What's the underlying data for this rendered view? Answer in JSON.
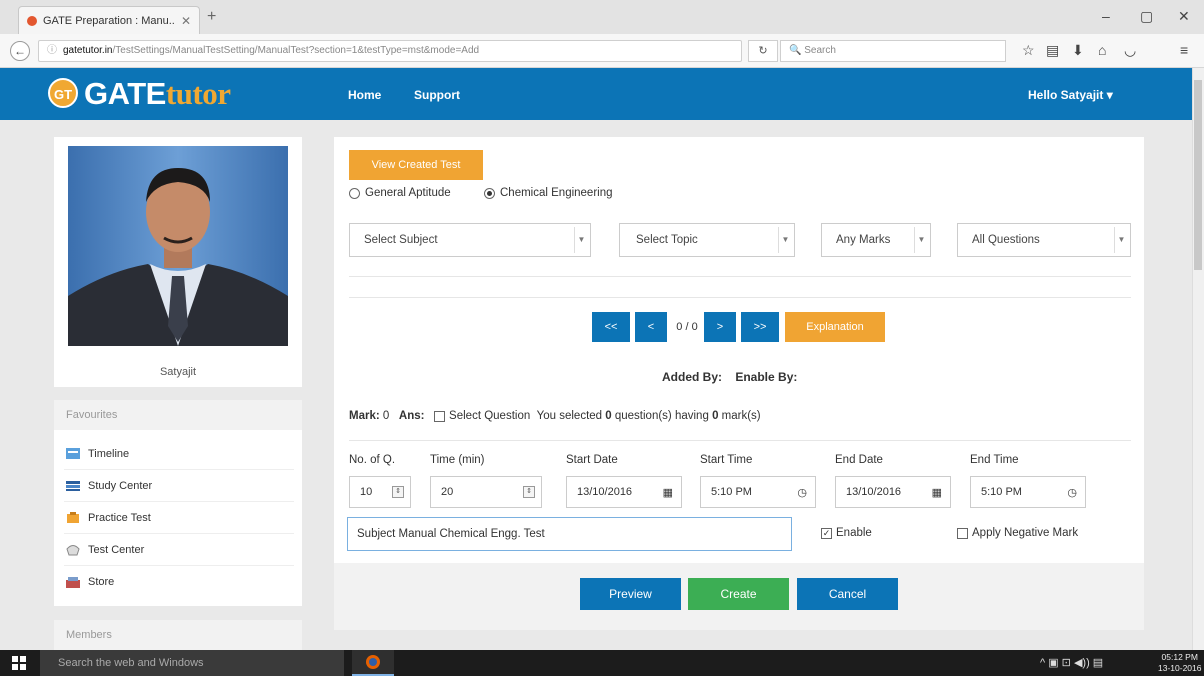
{
  "browser": {
    "tab_title": "GATE Preparation : Manu...",
    "url_host": "gatetutor.in",
    "url_path": "/TestSettings/ManualTestSetting/ManualTest?section=1&testType=mst&mode=Add",
    "search_placeholder": "Search",
    "reload_icon": "↻",
    "icons": [
      "star-icon",
      "reader-icon",
      "download-icon",
      "home-icon",
      "pocket-icon",
      "menu-icon"
    ]
  },
  "site": {
    "logo_badge": "GT",
    "logo_main": "GATE",
    "logo_sub": "tutor",
    "nav": [
      "Home",
      "Support"
    ],
    "user_menu": "Hello Satyajit ▾",
    "brand_color": "#0c74b6",
    "accent_color": "#f0a433"
  },
  "sidebar": {
    "username": "Satyajit",
    "favourites_heading": "Favourites",
    "items": [
      {
        "label": "Timeline",
        "icon": "timeline-icon"
      },
      {
        "label": "Study Center",
        "icon": "study-center-icon"
      },
      {
        "label": "Practice Test",
        "icon": "practice-test-icon"
      },
      {
        "label": "Test Center",
        "icon": "test-center-icon"
      },
      {
        "label": "Store",
        "icon": "store-icon"
      }
    ],
    "members_heading": "Members"
  },
  "main": {
    "view_created_label": "View Created Test",
    "radios": [
      {
        "label": "General Aptitude",
        "checked": false
      },
      {
        "label": "Chemical Engineering",
        "checked": true
      }
    ],
    "selects": [
      "Select Subject",
      "Select Topic",
      "Any Marks",
      "All Questions"
    ],
    "pager": {
      "first": "<<",
      "prev": "<",
      "counter": "0 / 0",
      "next": ">",
      "last": ">>"
    },
    "explanation_label": "Explanation",
    "added_by_label": "Added By:",
    "enable_by_label": "Enable By:",
    "mark_label": "Mark:",
    "mark_value": "0",
    "ans_label": "Ans:",
    "select_question_label": "Select Question",
    "selected_prefix": "You selected",
    "selected_count": "0",
    "selected_mid": "question(s) having",
    "selected_marks": "0",
    "selected_suffix": "mark(s)",
    "fields": {
      "no_of_q": {
        "label": "No. of Q.",
        "value": "10"
      },
      "time_min": {
        "label": "Time (min)",
        "value": "20"
      },
      "start_date": {
        "label": "Start Date",
        "value": "13/10/2016"
      },
      "start_time": {
        "label": "Start Time",
        "value": "5:10 PM"
      },
      "end_date": {
        "label": "End Date",
        "value": "13/10/2016"
      },
      "end_time": {
        "label": "End Time",
        "value": "5:10 PM"
      }
    },
    "test_name_value": "Subject Manual  Chemical Engg. Test",
    "enable_label": "Enable",
    "enable_checked": true,
    "negative_label": "Apply Negative Mark",
    "negative_checked": false,
    "buttons": {
      "preview": "Preview",
      "create": "Create",
      "cancel": "Cancel"
    }
  },
  "taskbar": {
    "search_placeholder": "Search the web and Windows",
    "time": "05:12 PM",
    "date": "13-10-2016"
  }
}
